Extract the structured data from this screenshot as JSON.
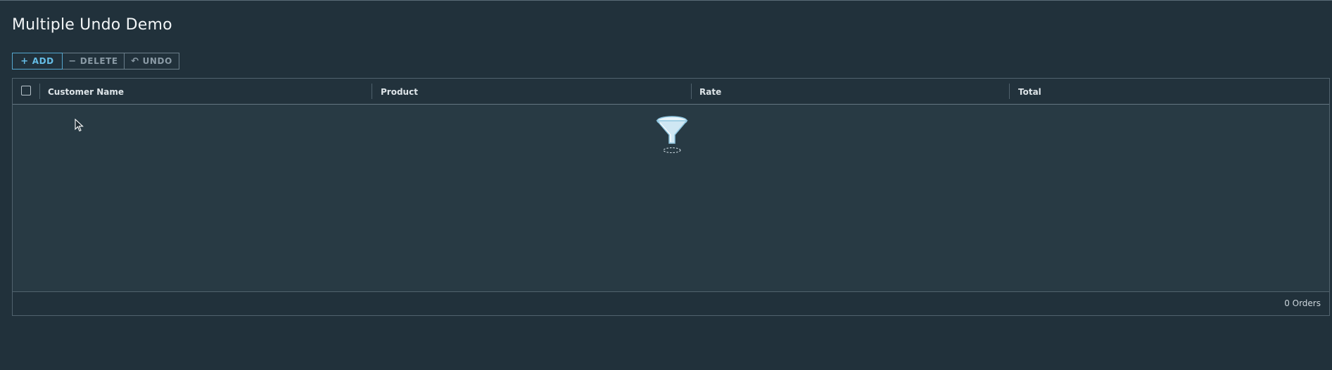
{
  "page": {
    "title": "Multiple Undo Demo"
  },
  "toolbar": {
    "add_label": "ADD",
    "delete_label": "DELETE",
    "undo_label": "UNDO"
  },
  "grid": {
    "columns": [
      "Customer Name",
      "Product",
      "Rate",
      "Total"
    ],
    "rows": [],
    "empty_icon": "funnel-icon",
    "footer_count": "0 Orders"
  },
  "colors": {
    "background": "#21313b",
    "grid_body": "#283a44",
    "accent": "#56a7cf"
  }
}
